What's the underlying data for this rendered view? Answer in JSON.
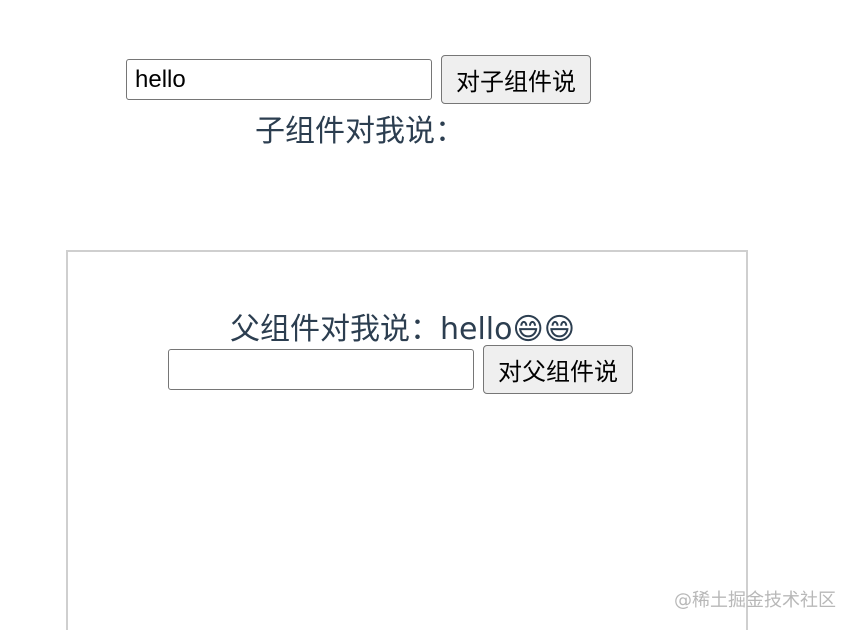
{
  "parent": {
    "input_value": "hello",
    "button_label": "对子组件说",
    "said_prefix": "子组件对我说："
  },
  "child": {
    "said_prefix": "父组件对我说：",
    "said_text": "hello😄😄",
    "input_value": "",
    "button_label": "对父组件说"
  },
  "watermark": "@稀土掘金技术社区"
}
